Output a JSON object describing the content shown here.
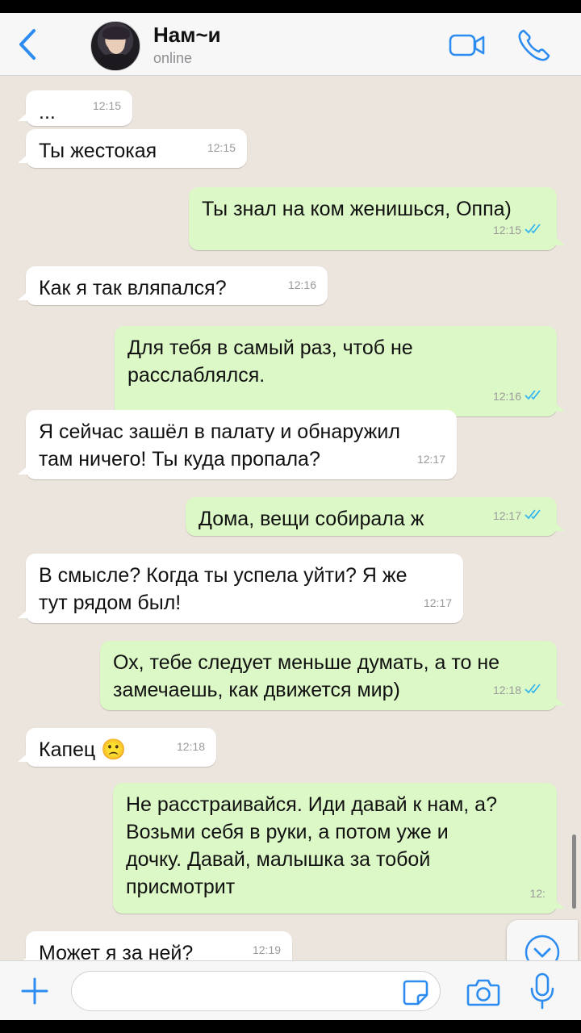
{
  "header": {
    "contact_name": "Нам~и",
    "status": "online"
  },
  "colors": {
    "accent": "#2d8cf0",
    "incoming_bubble": "#ffffff",
    "outgoing_bubble": "#dcf8c6",
    "chat_background": "#ece5dd",
    "read_ticks": "#34b7f1"
  },
  "icons": [
    "back-chevron-icon",
    "video-call-icon",
    "phone-icon",
    "scroll-down-icon",
    "plus-icon",
    "sticker-icon",
    "camera-icon",
    "microphone-icon"
  ],
  "messages": [
    {
      "dir": "in",
      "text": "...",
      "time": "12:15"
    },
    {
      "dir": "in",
      "text": "Ты жестокая",
      "time": "12:15"
    },
    {
      "dir": "out",
      "text": "Ты знал на ком женишься, Оппа)",
      "time": "12:15",
      "read": true
    },
    {
      "dir": "in",
      "text": "Как я так вляпался?",
      "time": "12:16"
    },
    {
      "dir": "out",
      "text": "Для тебя в самый раз, чтоб не\nрасслаблялся.",
      "time": "12:16",
      "read": true
    },
    {
      "dir": "in",
      "text": "Я сейчас зашёл в палату и обнаружил\nтам ничего! Ты куда пропала?",
      "time": "12:17"
    },
    {
      "dir": "out",
      "text": "Дома, вещи собирала ж",
      "time": "12:17",
      "read": true
    },
    {
      "dir": "in",
      "text": "В смысле? Когда ты успела уйти? Я же\nтут рядом был!",
      "time": "12:17"
    },
    {
      "dir": "out",
      "text": "Ох, тебе следует меньше думать, а то не\nзамечаешь, как движется мир)",
      "time": "12:18",
      "read": true
    },
    {
      "dir": "in",
      "text": "Капец 🙁",
      "time": "12:18"
    },
    {
      "dir": "out",
      "text": "Не расстраивайся. Иди давай к нам, а?\nВозьми себя в руки, а потом уже и\nдочку. Давай, малышка за тобой\nприсмотрит",
      "time": "12:",
      "read": false
    },
    {
      "dir": "in",
      "text": "Может я за ней?",
      "time": "12:19"
    }
  ],
  "input": {
    "value": "",
    "placeholder": ""
  }
}
